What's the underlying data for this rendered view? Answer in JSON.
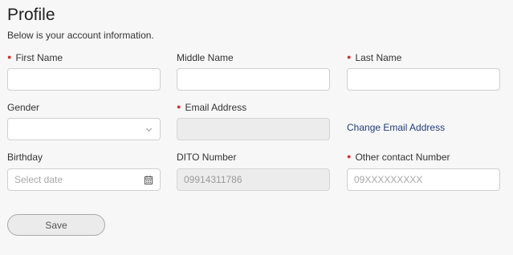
{
  "header": {
    "title": "Profile",
    "subtitle": "Below is your account information."
  },
  "fields": {
    "first_name": {
      "label": "First Name",
      "required": true,
      "value": "",
      "placeholder": ""
    },
    "middle_name": {
      "label": "Middle Name",
      "required": false,
      "value": "",
      "placeholder": ""
    },
    "last_name": {
      "label": "Last Name",
      "required": true,
      "value": "",
      "placeholder": ""
    },
    "gender": {
      "label": "Gender",
      "required": false,
      "selected": ""
    },
    "email": {
      "label": "Email Address",
      "required": true,
      "value": "",
      "disabled": true
    },
    "change_email_link": "Change Email Address",
    "birthday": {
      "label": "Birthday",
      "required": false,
      "placeholder": "Select date"
    },
    "dito_number": {
      "label": "DITO Number",
      "required": false,
      "placeholder": "09914311786",
      "disabled": true
    },
    "other_contact": {
      "label": "Other contact Number",
      "required": true,
      "placeholder": "09XXXXXXXXX"
    }
  },
  "actions": {
    "save_label": "Save"
  },
  "colors": {
    "required_marker": "#d32f2f",
    "link": "#1f3d7a",
    "background": "#f7f7f7",
    "disabled_field": "#ececec"
  },
  "icons": {
    "gender_dropdown": "chevron-down-icon",
    "birthday_picker": "calendar-icon"
  }
}
